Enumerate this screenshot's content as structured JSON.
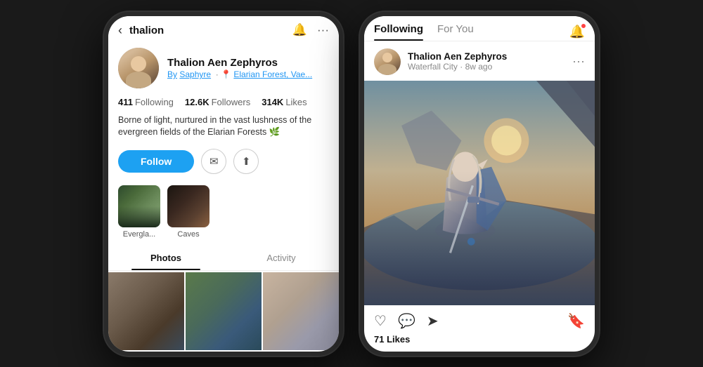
{
  "left_phone": {
    "header": {
      "back_icon": "‹",
      "title": "thalion",
      "bell_icon": "🔔",
      "more_icon": "···"
    },
    "profile": {
      "name": "Thalion Aen Zephyros",
      "by_label": "By",
      "by_creator": "Saphyre",
      "location": "Elarian Forest, Vae...",
      "stats": [
        {
          "num": "411",
          "label": "Following"
        },
        {
          "num": "12.6K",
          "label": "Followers"
        },
        {
          "num": "314K",
          "label": "Likes"
        }
      ],
      "bio": "Borne of light, nurtured in the vast lushness of the evergreen fields of the Elarian Forests 🌿",
      "follow_label": "Follow"
    },
    "albums": [
      {
        "label": "Evergla..."
      },
      {
        "label": "Caves"
      }
    ],
    "tabs": [
      {
        "label": "Photos",
        "active": true
      },
      {
        "label": "Activity",
        "active": false
      }
    ]
  },
  "right_phone": {
    "header": {
      "tabs": [
        {
          "label": "Following",
          "active": true
        },
        {
          "label": "For You",
          "active": false
        }
      ],
      "bell_icon": "🔔"
    },
    "post": {
      "author": "Thalion Aen Zephyros",
      "meta": "Waterfall City · 8w ago",
      "more_icon": "···",
      "likes": "71 Likes"
    }
  }
}
